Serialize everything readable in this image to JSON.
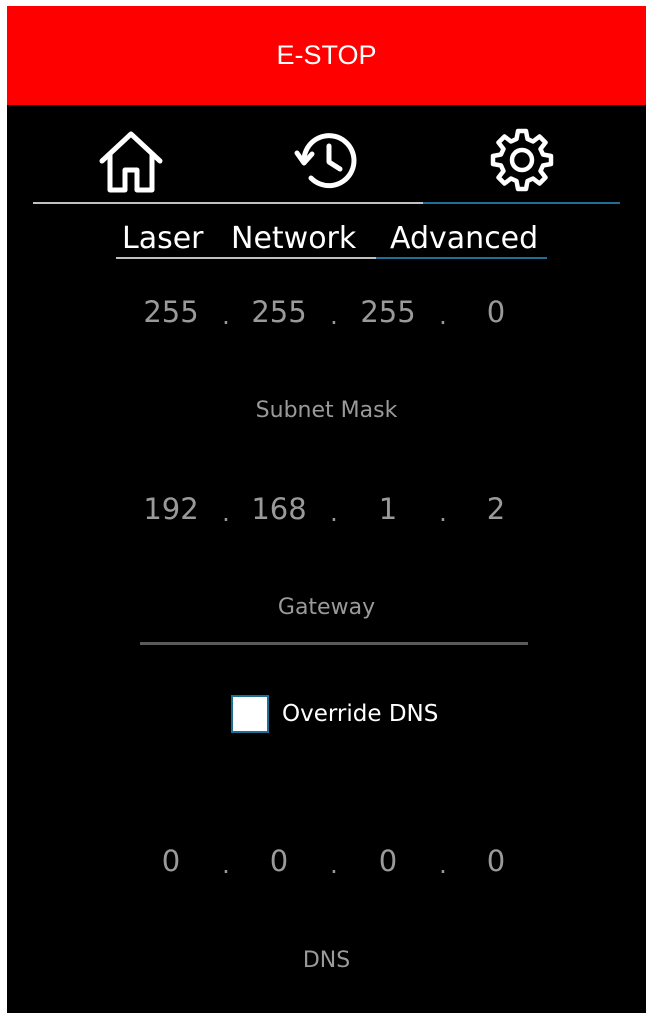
{
  "estop": {
    "label": "E-STOP"
  },
  "nav": {
    "items": [
      {
        "icon": "home-icon",
        "selected": false
      },
      {
        "icon": "history-icon",
        "selected": false
      },
      {
        "icon": "gear-icon",
        "selected": true
      }
    ]
  },
  "subtabs": [
    {
      "label": "Laser",
      "selected": false
    },
    {
      "label": "Network",
      "selected": false
    },
    {
      "label": "Advanced",
      "selected": true
    }
  ],
  "fields": {
    "subnet": {
      "octets": [
        "255",
        "255",
        "255",
        "0"
      ],
      "label": "Subnet Mask"
    },
    "gateway": {
      "octets": [
        "192",
        "168",
        "1",
        "2"
      ],
      "label": "Gateway"
    },
    "dns": {
      "octets": [
        "0",
        "0",
        "0",
        "0"
      ],
      "label": "DNS"
    }
  },
  "override_dns": {
    "label": "Override DNS",
    "checked": false
  },
  "octet_separator": ".",
  "colors": {
    "estop_bg": "#ff0000",
    "background": "#000000",
    "accent": "#1f6e96",
    "inactive_line": "#c0c0c0",
    "field_text": "#9a9a9a"
  }
}
